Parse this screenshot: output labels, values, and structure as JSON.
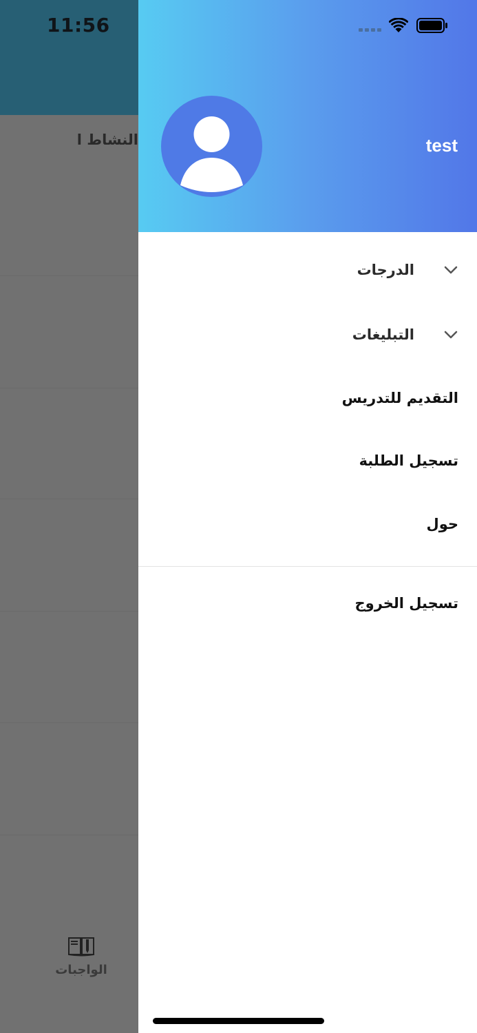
{
  "status_bar": {
    "time": "11:56"
  },
  "background": {
    "section_title": "النشاط الاخير",
    "tab_label": "الواجبات",
    "tab_icon": "book-icon"
  },
  "drawer": {
    "username": "test",
    "avatar_icon": "user-icon",
    "gradient": [
      "#57cbf2",
      "#5277e8"
    ],
    "menu": {
      "grades": "الدرجات",
      "notifications": "التبليغات",
      "apply_teaching": "التقديم للتدريس",
      "student_registration": "تسجيل الطلبة",
      "about": "حول",
      "logout": "تسجيل الخروج"
    }
  }
}
